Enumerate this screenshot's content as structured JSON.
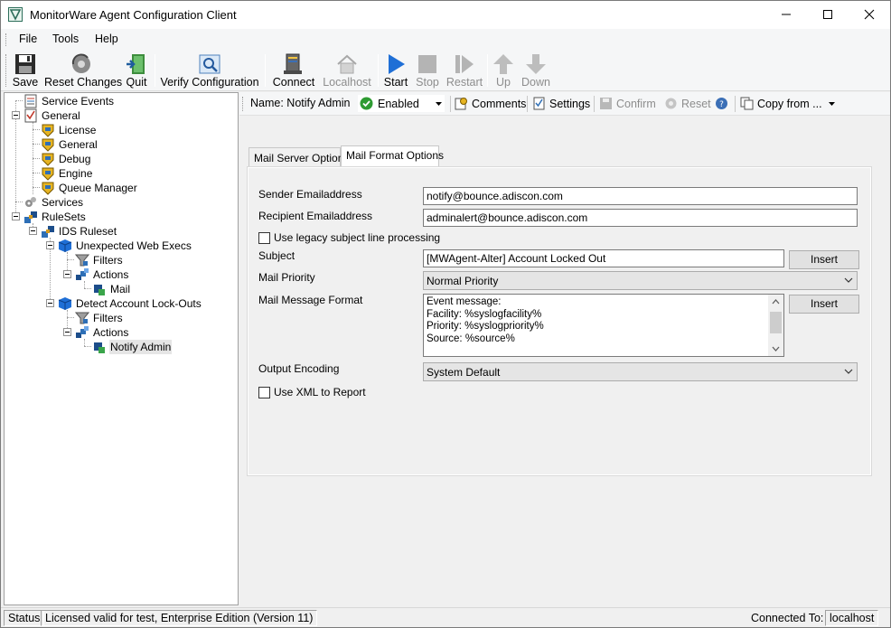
{
  "window": {
    "title": "MonitorWare Agent Configuration Client"
  },
  "menu": [
    "File",
    "Tools",
    "Help"
  ],
  "toolbar": {
    "save": "Save",
    "reset_changes": "Reset Changes",
    "quit": "Quit",
    "verify_configuration": "Verify Configuration",
    "connect": "Connect",
    "localhost": "Localhost",
    "start": "Start",
    "stop": "Stop",
    "restart": "Restart",
    "up": "Up",
    "down": "Down"
  },
  "tree": {
    "service_events": "Service Events",
    "general": "General",
    "license": "License",
    "general_child": "General",
    "debug": "Debug",
    "engine": "Engine",
    "queue_manager": "Queue Manager",
    "services": "Services",
    "rulesets": "RuleSets",
    "ids_ruleset": "IDS Ruleset",
    "unexpected_web_execs": "Unexpected Web Execs",
    "filters_1": "Filters",
    "actions_1": "Actions",
    "mail": "Mail",
    "detect_account_lockouts": "Detect Account Lock-Outs",
    "filters_2": "Filters",
    "actions_2": "Actions",
    "notify_admin": "Notify Admin"
  },
  "action_bar": {
    "name_label": "Name: Notify Admin",
    "state": "Enabled",
    "comments": "Comments",
    "settings": "Settings",
    "confirm": "Confirm",
    "reset": "Reset",
    "copy_from": "Copy from ..."
  },
  "tabs": {
    "mail_server_options": "Mail Server Options",
    "mail_format_options": "Mail Format Options"
  },
  "form": {
    "sender_label": "Sender Emailaddress",
    "sender_value": "notify@bounce.adiscon.com",
    "recipient_label": "Recipient Emailaddress",
    "recipient_value": "adminalert@bounce.adiscon.com",
    "legacy_subject_label": "Use legacy subject line processing",
    "legacy_subject_checked": false,
    "subject_label": "Subject",
    "subject_value": "[MWAgent-Alter] Account Locked Out",
    "insert_label": "Insert",
    "mail_priority_label": "Mail Priority",
    "mail_priority_value": "Normal Priority",
    "message_format_label": "Mail Message Format",
    "message_lines": [
      "Event message:",
      "Facility: %syslogfacility%",
      "Priority: %syslogpriority%",
      "Source: %source%"
    ],
    "output_encoding_label": "Output Encoding",
    "output_encoding_value": "System Default",
    "use_xml_label": "Use XML to Report",
    "use_xml_checked": false
  },
  "status": {
    "status_label": "Status",
    "license_text": "Licensed valid for test, Enterprise Edition (Version 11)",
    "connected_label": "Connected To:",
    "connected_host": "localhost"
  },
  "colors": {
    "start_blue": "#1f6fd6",
    "enabled_green": "#2e9b32",
    "selection": "#e5e5e5"
  }
}
